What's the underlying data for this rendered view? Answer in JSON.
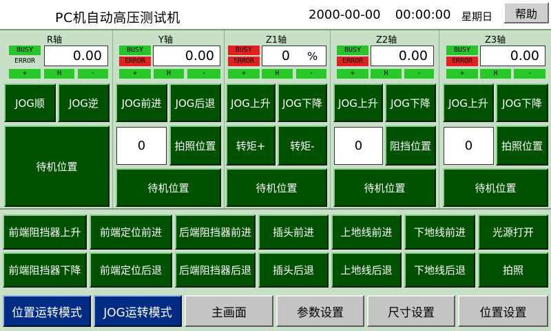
{
  "header": {
    "title": "PC机自动高压测试机",
    "date": "2000-00-00",
    "time": "00:00:00",
    "weekday": "星期日",
    "help_label": "帮助"
  },
  "status_labels": {
    "busy": "BUSY",
    "error": "ERROR"
  },
  "mini_labels": {
    "plus": "+",
    "home": "H",
    "minus": "-"
  },
  "axes": [
    {
      "name": "R轴",
      "value": "0.00",
      "busy_active": true,
      "error_active": false,
      "jog_plus": "JOG顺",
      "jog_minus": "JOG逆",
      "standby": "待机位置"
    },
    {
      "name": "Y轴",
      "value": "0.00",
      "busy_active": true,
      "error_active": true,
      "jog_plus": "JOG前进",
      "jog_minus": "JOG后退",
      "input": "0",
      "photo": "拍照位置",
      "standby": "待机位置"
    },
    {
      "name": "Z1轴",
      "value": "0",
      "unit": "%",
      "busy_active": false,
      "error_active": true,
      "jog_plus": "JOG上升",
      "jog_minus": "JOG下降",
      "torque_plus": "转矩+",
      "torque_minus": "转矩-",
      "standby": "待机位置"
    },
    {
      "name": "Z2轴",
      "value": "0.00",
      "busy_active": true,
      "error_active": true,
      "jog_plus": "JOG上升",
      "jog_minus": "JOG下降",
      "input": "0",
      "block": "阻挡位置",
      "standby": "待机位置"
    },
    {
      "name": "Z3轴",
      "value": "0.00",
      "busy_active": true,
      "error_active": true,
      "jog_plus": "JOG上升",
      "jog_minus": "JOG下降",
      "input": "0",
      "photo": "拍照位置",
      "standby": "待机位置"
    }
  ],
  "actions": {
    "row1": [
      "前端阻挡器上升",
      "前端定位前进",
      "后端阻挡器前进",
      "插头前进",
      "上地线前进",
      "下地线前进",
      "光源打开"
    ],
    "row2": [
      "前端阻挡器下降",
      "前端定位后退",
      "后端阻挡器后退",
      "插头后退",
      "上地线后退",
      "下地线后退",
      "拍照"
    ]
  },
  "nav": {
    "position_mode": "位置运转模式",
    "jog_mode": "JOG运转模式",
    "main": "主画面",
    "params": "参数设置",
    "size": "尺寸设置",
    "position": "位置设置"
  },
  "colors": {
    "button_green": "#005200",
    "panel_bg": "#c7e0c7",
    "busy_green": "#29c429",
    "error_red": "#e22020",
    "mode_blue": "#002c86",
    "nav_gray": "#c4c4c4"
  }
}
